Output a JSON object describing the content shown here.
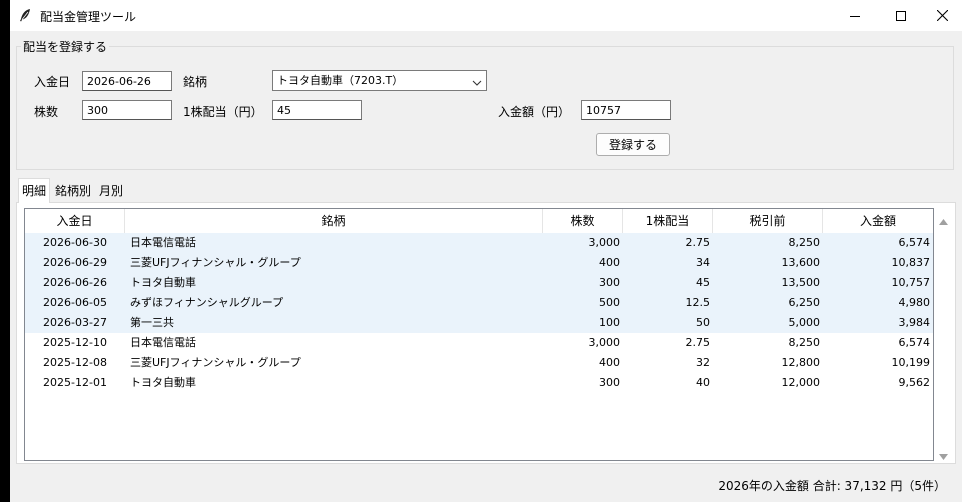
{
  "window": {
    "title": "配当金管理ツール"
  },
  "form": {
    "legend": "配当を登録する",
    "date_label": "入金日",
    "date_value": "2026-06-26",
    "ticker_label": "銘柄",
    "ticker_value": "トヨタ自動車（7203.T）",
    "shares_label": "株数",
    "shares_value": "300",
    "dps_label": "1株配当（円）",
    "dps_value": "45",
    "amount_label": "入金額（円）",
    "amount_value": "10757",
    "submit_label": "登録する"
  },
  "tabs": [
    {
      "label": "明細",
      "active": true
    },
    {
      "label": "銘柄別",
      "active": false
    },
    {
      "label": "月別",
      "active": false
    }
  ],
  "table": {
    "columns": [
      "入金日",
      "銘柄",
      "株数",
      "1株配当",
      "税引前",
      "入金額"
    ],
    "rows": [
      {
        "date": "2026-06-30",
        "name": "日本電信電話",
        "shares": "3,000",
        "dps": "2.75",
        "gross": "8,250",
        "net": "6,574",
        "highlight": true
      },
      {
        "date": "2026-06-29",
        "name": "三菱UFJフィナンシャル・グループ",
        "shares": "400",
        "dps": "34",
        "gross": "13,600",
        "net": "10,837",
        "highlight": true
      },
      {
        "date": "2026-06-26",
        "name": "トヨタ自動車",
        "shares": "300",
        "dps": "45",
        "gross": "13,500",
        "net": "10,757",
        "highlight": true
      },
      {
        "date": "2026-06-05",
        "name": "みずほフィナンシャルグループ",
        "shares": "500",
        "dps": "12.5",
        "gross": "6,250",
        "net": "4,980",
        "highlight": true
      },
      {
        "date": "2026-03-27",
        "name": "第一三共",
        "shares": "100",
        "dps": "50",
        "gross": "5,000",
        "net": "3,984",
        "highlight": true
      },
      {
        "date": "2025-12-10",
        "name": "日本電信電話",
        "shares": "3,000",
        "dps": "2.75",
        "gross": "8,250",
        "net": "6,574",
        "highlight": false
      },
      {
        "date": "2025-12-08",
        "name": "三菱UFJフィナンシャル・グループ",
        "shares": "400",
        "dps": "32",
        "gross": "12,800",
        "net": "10,199",
        "highlight": false
      },
      {
        "date": "2025-12-01",
        "name": "トヨタ自動車",
        "shares": "300",
        "dps": "40",
        "gross": "12,000",
        "net": "9,562",
        "highlight": false
      }
    ]
  },
  "status": {
    "text": "2026年の入金額 合計: 37,132 円（5件）"
  },
  "icons": {
    "app": "feather-icon",
    "minimize": "minimize-icon",
    "maximize": "maximize-icon",
    "close": "close-icon",
    "dropdown": "chevron-down-icon",
    "scroll_up": "scroll-up-arrow-icon",
    "scroll_down": "scroll-down-arrow-icon"
  },
  "colors": {
    "highlight_row": "#eaf3fb",
    "window_bg": "#f0f0f0"
  }
}
